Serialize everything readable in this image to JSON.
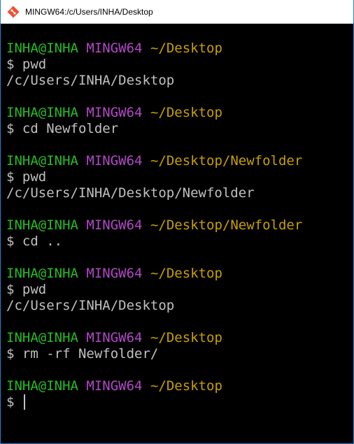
{
  "window": {
    "title": "MINGW64:/c/Users/INHA/Desktop"
  },
  "colors": {
    "user": "#25bc24",
    "host": "#b148c6",
    "path": "#c7a000",
    "text": "#c0c0c0",
    "background": "#000000"
  },
  "terminal": {
    "blocks": [
      {
        "user": "INHA@INHA",
        "host": "MINGW64",
        "path": "~/Desktop",
        "command": "$ pwd",
        "output": "/c/Users/INHA/Desktop"
      },
      {
        "user": "INHA@INHA",
        "host": "MINGW64",
        "path": "~/Desktop",
        "command": "$ cd Newfolder"
      },
      {
        "user": "INHA@INHA",
        "host": "MINGW64",
        "path": "~/Desktop/Newfolder",
        "command": "$ pwd",
        "output": "/c/Users/INHA/Desktop/Newfolder"
      },
      {
        "user": "INHA@INHA",
        "host": "MINGW64",
        "path": "~/Desktop/Newfolder",
        "command": "$ cd .."
      },
      {
        "user": "INHA@INHA",
        "host": "MINGW64",
        "path": "~/Desktop",
        "command": "$ pwd",
        "output": "/c/Users/INHA/Desktop"
      },
      {
        "user": "INHA@INHA",
        "host": "MINGW64",
        "path": "~/Desktop",
        "command": "$ rm -rf Newfolder/"
      },
      {
        "user": "INHA@INHA",
        "host": "MINGW64",
        "path": "~/Desktop",
        "command": "$ "
      }
    ]
  }
}
